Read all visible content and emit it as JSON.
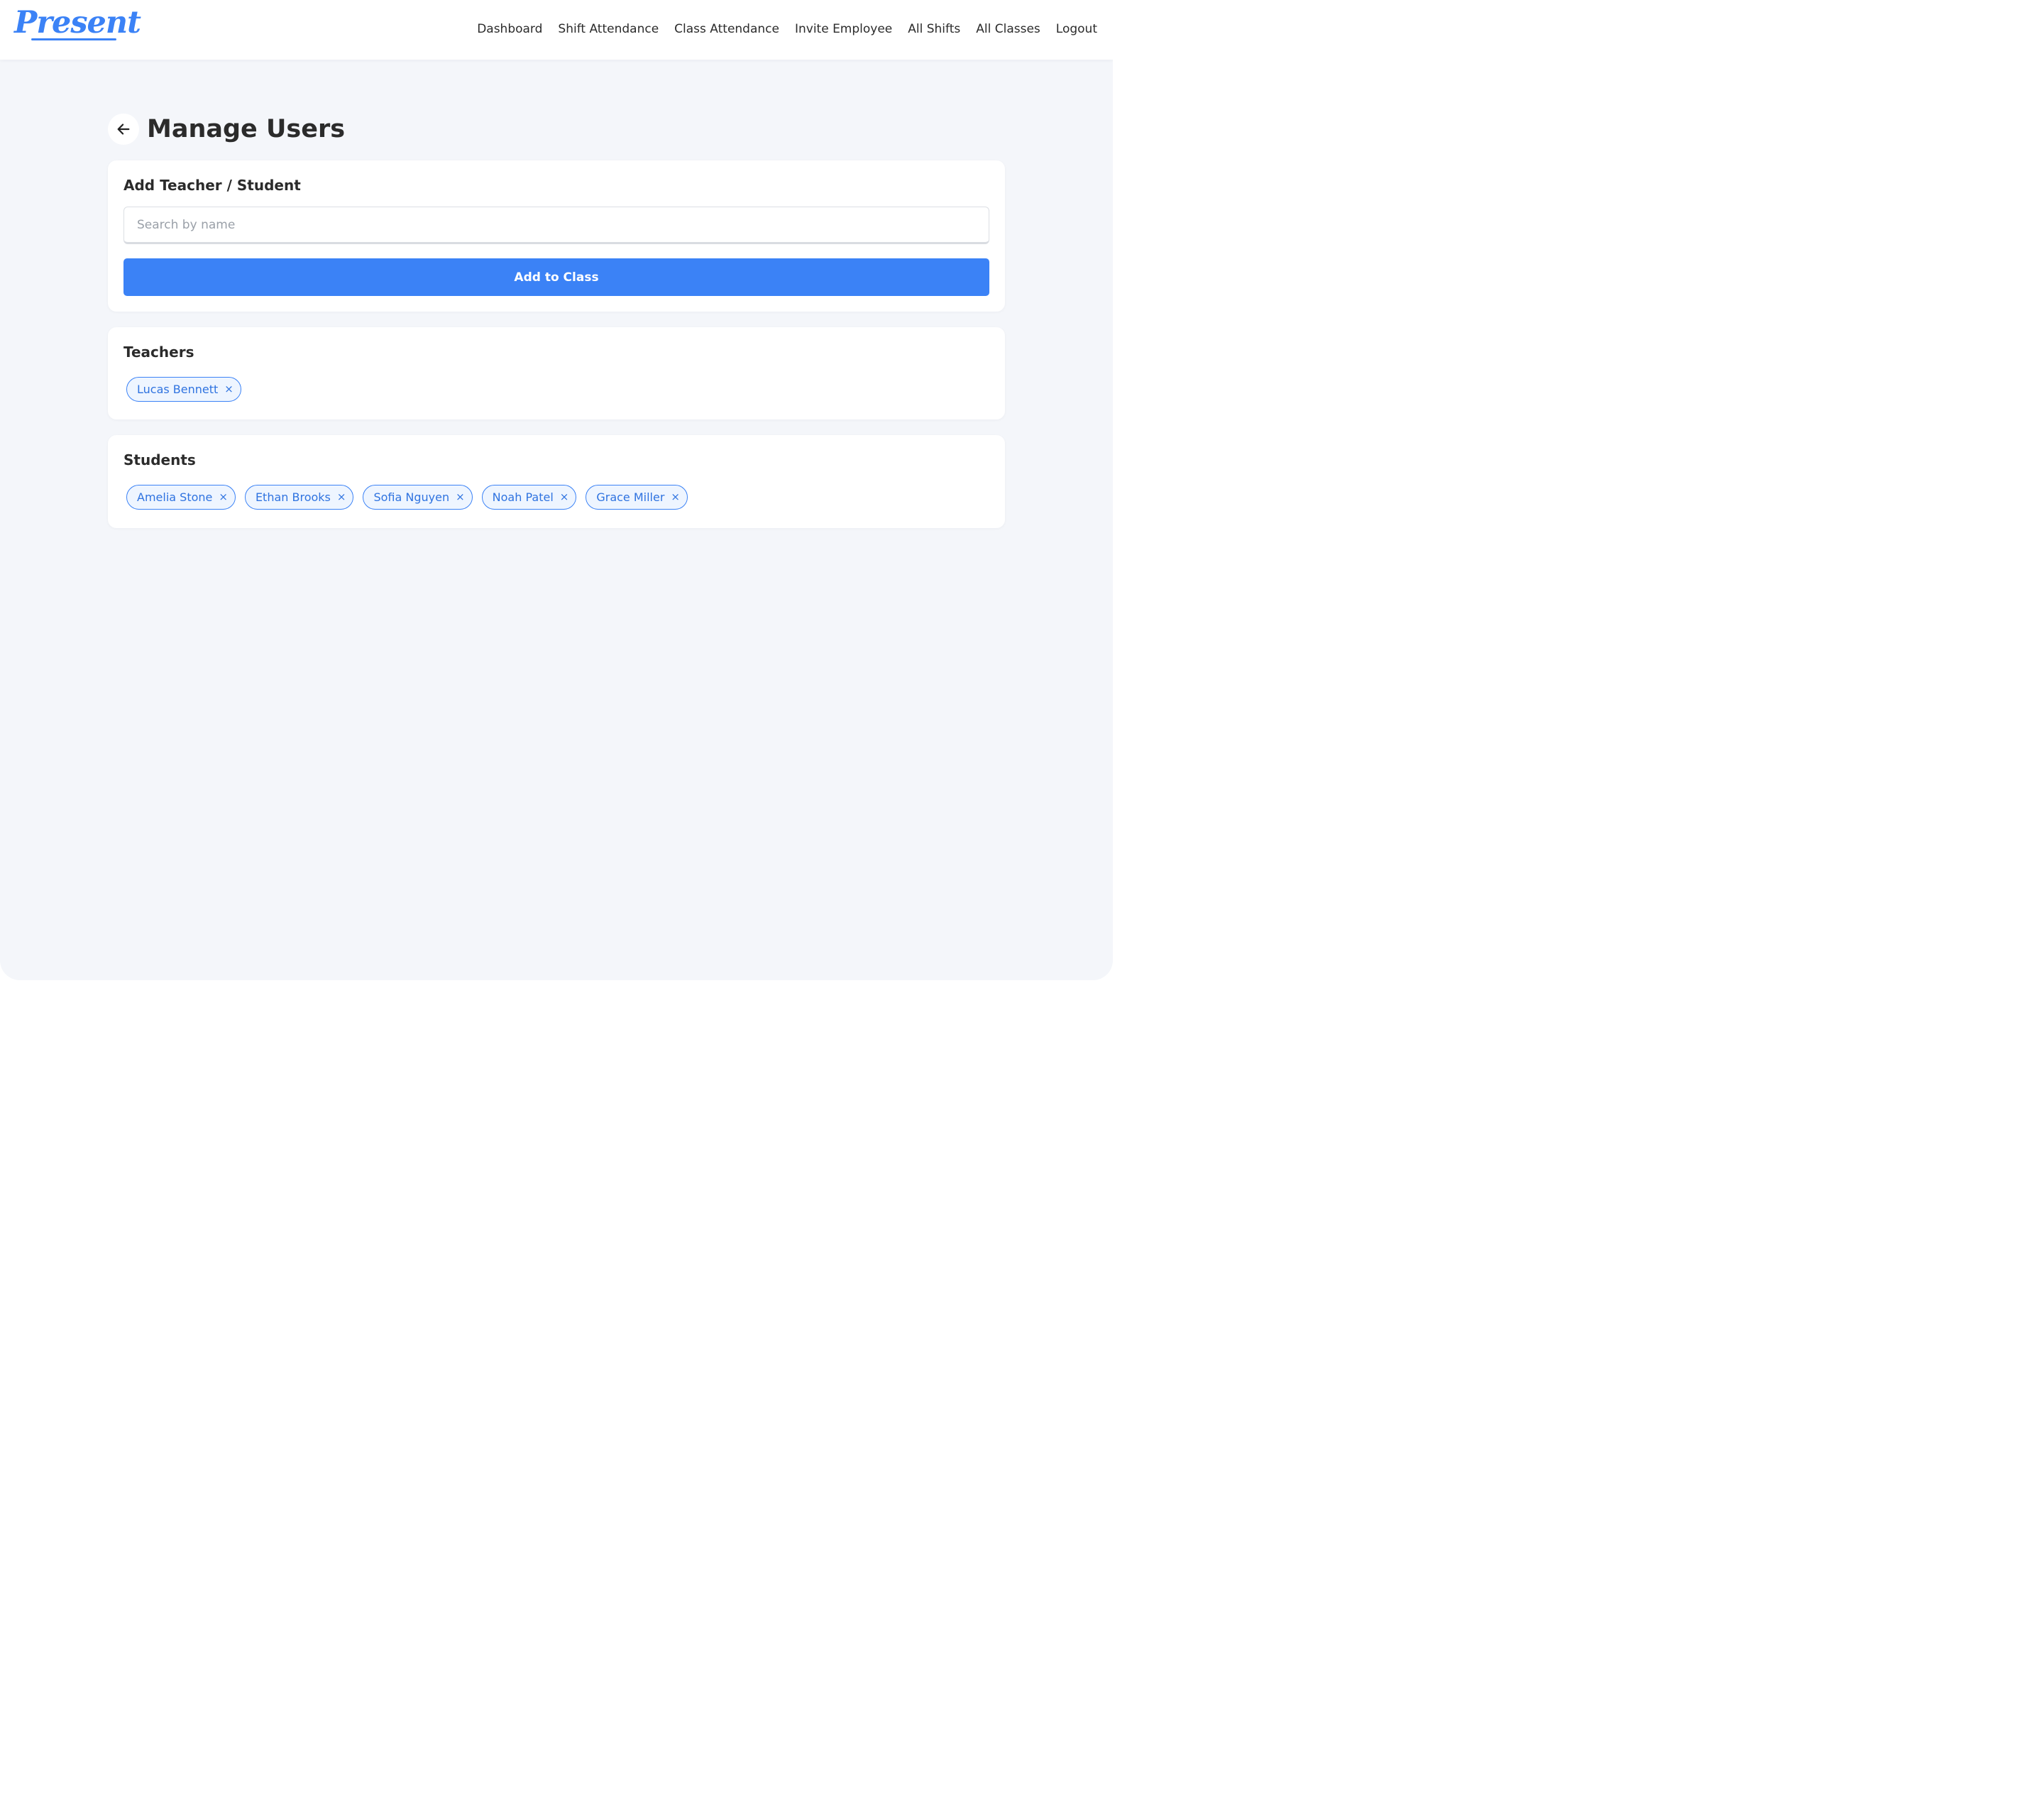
{
  "app": {
    "logo_text": "Present",
    "colors": {
      "accent": "#3b82f6",
      "background": "#f4f6fa",
      "text": "#2b2b2b"
    }
  },
  "nav": {
    "items": [
      "Dashboard",
      "Shift Attendance",
      "Class Attendance",
      "Invite Employee",
      "All Shifts",
      "All Classes",
      "Logout"
    ]
  },
  "page": {
    "title": "Manage Users",
    "back_icon": "arrow-left-icon"
  },
  "add_card": {
    "title": "Add Teacher / Student",
    "search_placeholder": "Search by name",
    "search_value": "",
    "button_label": "Add to Class"
  },
  "teachers": {
    "title": "Teachers",
    "items": [
      "Lucas Bennett"
    ]
  },
  "students": {
    "title": "Students",
    "items": [
      "Amelia Stone",
      "Ethan Brooks",
      "Sofia Nguyen",
      "Noah Patel",
      "Grace Miller"
    ]
  },
  "chip_remove_symbol": "×"
}
